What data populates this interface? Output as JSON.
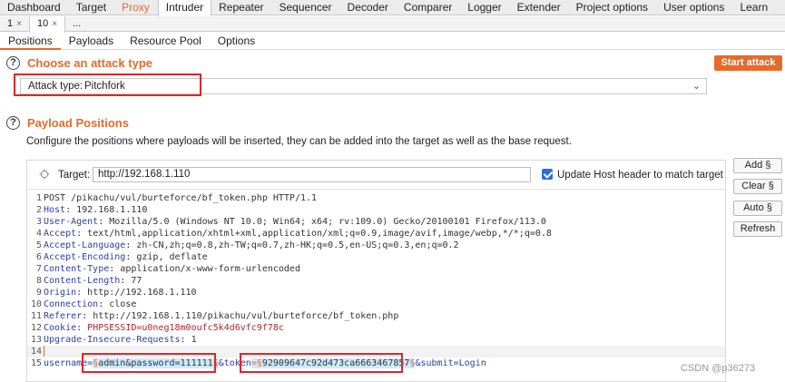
{
  "top_tabs": [
    "Dashboard",
    "Target",
    "Proxy",
    "Intruder",
    "Repeater",
    "Sequencer",
    "Decoder",
    "Comparer",
    "Logger",
    "Extender",
    "Project options",
    "User options",
    "Learn"
  ],
  "instance_tabs": [
    "1",
    "10",
    "..."
  ],
  "close_glyph": "×",
  "section_tabs": [
    "Positions",
    "Payloads",
    "Resource Pool",
    "Options"
  ],
  "help_glyph": "?",
  "attack_section": {
    "title": "Choose an attack type",
    "start_button": "Start attack",
    "attack_type_label": "Attack type:",
    "attack_type_value": "Pitchfork",
    "dropdown_glyph": "⌄"
  },
  "payload_section": {
    "title": "Payload Positions",
    "description": "Configure the positions where payloads will be inserted, they can be added into the target as well as the base request.",
    "target_label": "Target:",
    "target_value": "http://192.168.1.110",
    "update_host_label": "Update Host header to match target"
  },
  "side_buttons": [
    "Add §",
    "Clear §",
    "Auto §",
    "Refresh"
  ],
  "request": {
    "line1": "POST /pikachu/vul/burteforce/bf_token.php HTTP/1.1",
    "headers": [
      {
        "k": "Host",
        "v": "192.168.1.110"
      },
      {
        "k": "User-Agent",
        "v": "Mozilla/5.0 (Windows NT 10.0; Win64; x64; rv:109.0) Gecko/20100101 Firefox/113.0"
      },
      {
        "k": "Accept",
        "v": "text/html,application/xhtml+xml,application/xml;q=0.9,image/avif,image/webp,*/*;q=0.8"
      },
      {
        "k": "Accept-Language",
        "v": "zh-CN,zh;q=0.8,zh-TW;q=0.7,zh-HK;q=0.5,en-US;q=0.3,en;q=0.2"
      },
      {
        "k": "Accept-Encoding",
        "v": "gzip, deflate"
      },
      {
        "k": "Content-Type",
        "v": "application/x-www-form-urlencoded"
      },
      {
        "k": "Content-Length",
        "v": "77"
      },
      {
        "k": "Origin",
        "v": "http://192.168.1.110"
      },
      {
        "k": "Connection",
        "v": "close"
      },
      {
        "k": "Referer",
        "v": "http://192.168.1.110/pikachu/vul/burteforce/bf_token.php"
      }
    ],
    "cookie_key": "Cookie",
    "cookie_name": "PHPSESSID",
    "cookie_value": "u0neg18m0oufc5k4d6vfc9f78c",
    "upgrade_key": "Upgrade-Insecure-Requests",
    "upgrade_value": "1",
    "line_numbers": [
      "1",
      "2",
      "3",
      "4",
      "5",
      "6",
      "7",
      "8",
      "9",
      "10",
      "11",
      "12",
      "13",
      "14",
      "15"
    ],
    "body": {
      "p1": "username=",
      "marker": "§",
      "payload1": "admin&password=111111",
      "p2": "&token",
      "p3": "=",
      "payload2": "92909647c92d473ca6663467857",
      "p4": "&submit=Login"
    }
  },
  "watermark": "CSDN @p36273"
}
